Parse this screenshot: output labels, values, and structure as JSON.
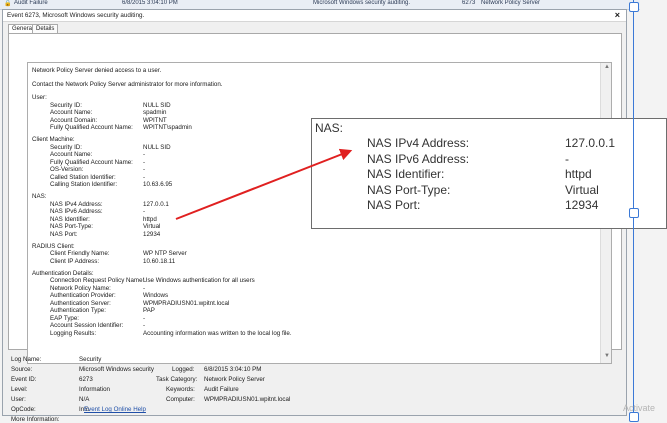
{
  "background_row": {
    "col1": "Audit Failure",
    "col2": "6/8/2015 3:04:10 PM",
    "col3": "Microsoft Windows security auditing.",
    "col4": "6273",
    "col5": "Network Policy Server"
  },
  "dialog": {
    "title": "Event 6273, Microsoft Windows security auditing.",
    "close_glyph": "×",
    "tabs": [
      "General",
      "Details"
    ]
  },
  "description": {
    "line1": "Network Policy Server denied access to a user.",
    "line2": "Contact the Network Policy Server administrator for more information.",
    "user": {
      "heading": "User:",
      "rows": [
        {
          "k": "Security ID:",
          "v": "NULL SID"
        },
        {
          "k": "Account Name:",
          "v": "spadmin"
        },
        {
          "k": "Account Domain:",
          "v": "WPITNT"
        },
        {
          "k": "Fully Qualified Account Name:",
          "v": "WPITNT\\spadmin"
        }
      ]
    },
    "client_machine": {
      "heading": "Client Machine:",
      "rows": [
        {
          "k": "Security ID:",
          "v": "NULL SID"
        },
        {
          "k": "Account Name:",
          "v": "-"
        },
        {
          "k": "Fully Qualified Account Name:",
          "v": "-"
        },
        {
          "k": "OS-Version:",
          "v": "-"
        },
        {
          "k": "Called Station Identifier:",
          "v": "-"
        },
        {
          "k": "Calling Station Identifier:",
          "v": "10.63.6.95"
        }
      ]
    },
    "nas": {
      "heading": "NAS:",
      "rows": [
        {
          "k": "NAS IPv4 Address:",
          "v": "127.0.0.1"
        },
        {
          "k": "NAS IPv6 Address:",
          "v": "-"
        },
        {
          "k": "NAS Identifier:",
          "v": "httpd"
        },
        {
          "k": "NAS Port-Type:",
          "v": "Virtual"
        },
        {
          "k": "NAS Port:",
          "v": "12934"
        }
      ]
    },
    "radius": {
      "heading": "RADIUS Client:",
      "rows": [
        {
          "k": "Client Friendly Name:",
          "v": "WP NTP Server"
        },
        {
          "k": "Client IP Address:",
          "v": "10.60.18.11"
        }
      ]
    },
    "auth": {
      "heading": "Authentication Details:",
      "rows": [
        {
          "k": "Connection Request Policy Name:",
          "v": "Use Windows authentication for all users"
        },
        {
          "k": "Network Policy Name:",
          "v": "-"
        },
        {
          "k": "Authentication Provider:",
          "v": "Windows"
        },
        {
          "k": "Authentication Server:",
          "v": "WPMPRADIUSN01.wpitnt.local"
        },
        {
          "k": "Authentication Type:",
          "v": "PAP"
        },
        {
          "k": "EAP Type:",
          "v": "-"
        },
        {
          "k": "Account Session Identifier:",
          "v": "-"
        },
        {
          "k": "Logging Results:",
          "v": "Accounting information was written to the local log file."
        }
      ]
    }
  },
  "properties": {
    "log_name_label": "Log Name:",
    "log_name": "Security",
    "source_label": "Source:",
    "source": "Microsoft Windows security",
    "logged_label": "Logged:",
    "logged": "6/8/2015 3:04:10 PM",
    "event_id_label": "Event ID:",
    "event_id": "6273",
    "task_label": "Task Category:",
    "task": "Network Policy Server",
    "level_label": "Level:",
    "level": "Information",
    "keywords_label": "Keywords:",
    "keywords": "Audit Failure",
    "user_label": "User:",
    "user": "N/A",
    "computer_label": "Computer:",
    "computer": "WPMPRADIUSN01.wpitnt.local",
    "opcode_label": "OpCode:",
    "opcode": "Info",
    "more_info_label": "More Information:",
    "more_info_link": "Event Log Online Help"
  },
  "callout": {
    "heading": "NAS:",
    "rows": [
      {
        "k": "NAS IPv4 Address:",
        "v": "127.0.0.1"
      },
      {
        "k": "NAS IPv6 Address:",
        "v": "-"
      },
      {
        "k": "NAS Identifier:",
        "v": "httpd"
      },
      {
        "k": "NAS Port-Type:",
        "v": "Virtual"
      },
      {
        "k": "NAS Port:",
        "v": "12934"
      }
    ]
  },
  "watermark": "Activate",
  "colors": {
    "arrow": "#e02020",
    "selection": "#3b79d6",
    "link": "#1f4fa8"
  }
}
